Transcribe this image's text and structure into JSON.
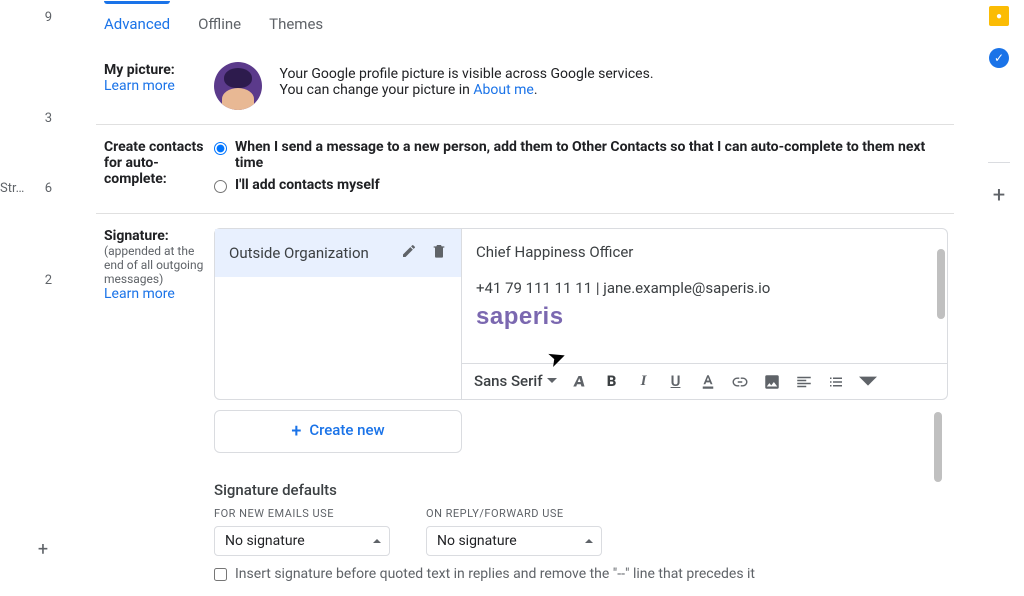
{
  "left_gutter": {
    "nums": [
      "9",
      "3",
      "6",
      "2"
    ],
    "label": "Str…"
  },
  "tabs": {
    "advanced": "Advanced",
    "offline": "Offline",
    "themes": "Themes"
  },
  "picture": {
    "title": "My picture:",
    "learn": "Learn more",
    "line1": "Your Google profile picture is visible across Google services.",
    "line2a": "You can change your picture in ",
    "about_link": "About me",
    "line2b": "."
  },
  "contacts": {
    "title_a": "Create contacts",
    "title_b": "for auto-",
    "title_c": "complete:",
    "option1": "When I send a message to a new person, add them to Other Contacts so that I can auto-complete to them next time",
    "option2": "I'll add contacts myself"
  },
  "signature": {
    "title": "Signature:",
    "sub1": "(appended at the",
    "sub2": "end of all outgoing",
    "sub3": "messages)",
    "learn": "Learn more",
    "items": [
      {
        "name": "Outside Organization"
      }
    ],
    "content": {
      "line1": "Chief Happiness Officer",
      "line2": "+41 79 111 11 11 | jane.example@saperis.io",
      "logo": "saperis"
    },
    "toolbar": {
      "font": "Sans Serif"
    },
    "create_new": "Create new"
  },
  "defaults": {
    "title": "Signature defaults",
    "for_new_label": "FOR NEW EMAILS USE",
    "on_reply_label": "ON REPLY/FORWARD USE",
    "for_new_value": "No signature",
    "on_reply_value": "No signature",
    "insert_label": "Insert signature before quoted text in replies and remove the \"--\" line that precedes it"
  }
}
